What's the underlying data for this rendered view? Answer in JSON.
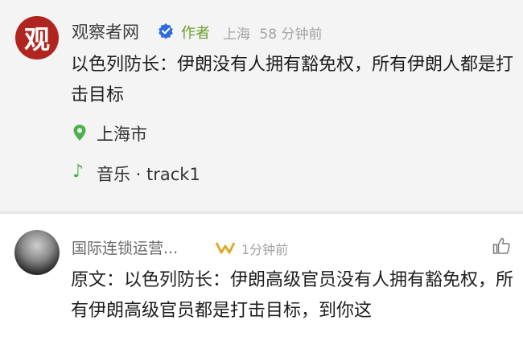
{
  "post": {
    "avatar_text": "观",
    "author": "观察者网",
    "author_tag": "作者",
    "location_meta": "上海",
    "time": "58 分钟前",
    "text": "以色列防长：伊朗没有人拥有豁免权，所有伊朗人都是打击目标",
    "location": "上海市",
    "music": "音乐 · track1",
    "colors": {
      "accent_green": "#4fb050",
      "verified_blue": "#2d6bdf",
      "avatar_red": "#b0251f"
    }
  },
  "comment": {
    "user": "国际连锁运营...",
    "time": "1分钟前",
    "text": "原文：以色列防长：伊朗高级官员没有人拥有豁免权，所有伊朗高级官员都是打击目标，到你这"
  }
}
